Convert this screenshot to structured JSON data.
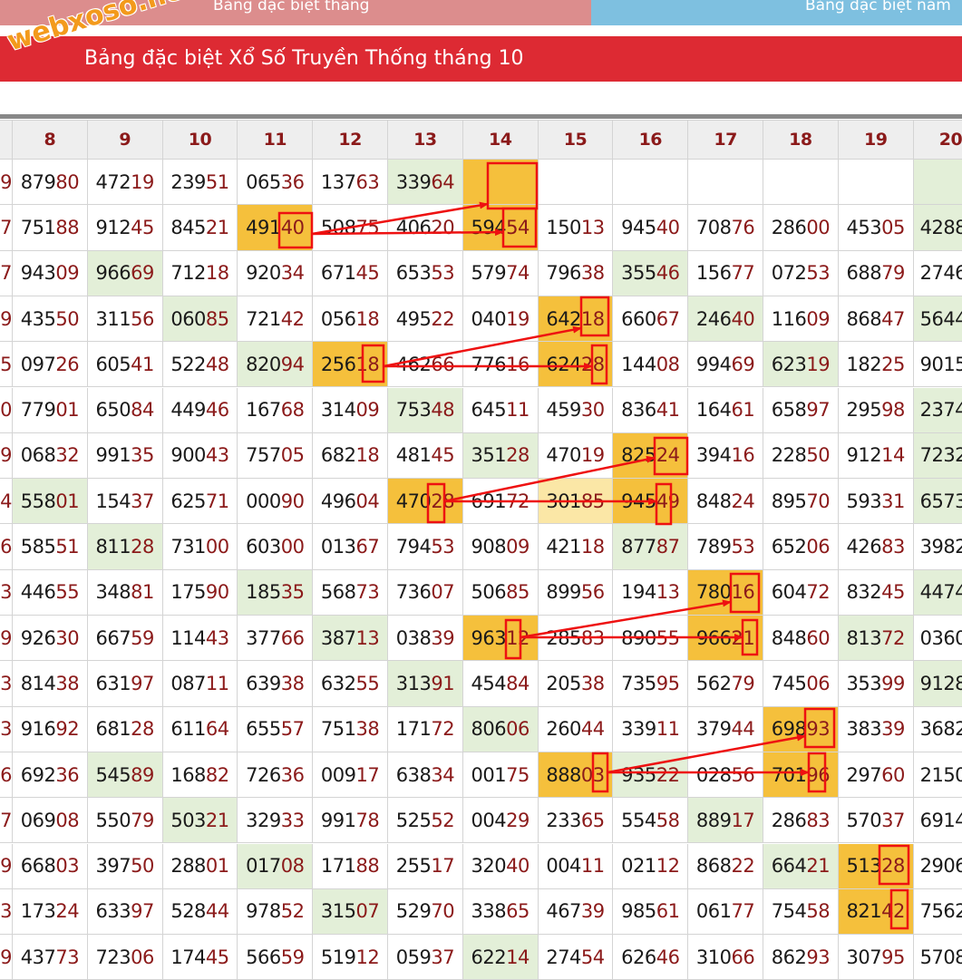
{
  "tabs": [
    {
      "label": "Bảng đặc biệt tháng",
      "color": "#dc8d8d"
    },
    {
      "label": "Bảng đặc biệt năm",
      "color": "#7ec0e0"
    }
  ],
  "watermark": "webxoso.net",
  "title": "Bảng đặc biệt Xổ Số Truyền Thống tháng 10",
  "colors": {
    "title_bg": "#dd2a33",
    "header_text": "#8b1a1a",
    "highlight_green": "#e3efd8",
    "highlight_orange": "#f5c03c",
    "highlight_pale": "#fbe7a6",
    "annotation": "#ee1111"
  },
  "table": {
    "left_edge_fragments": [
      "9",
      "7",
      "7",
      "9",
      "5",
      "0",
      "9",
      "4",
      "6",
      "3",
      "9",
      "3",
      "3",
      "6",
      "7",
      "9",
      "3",
      "9"
    ],
    "columns": [
      "8",
      "9",
      "10",
      "11",
      "12",
      "13",
      "14",
      "15",
      "16",
      "17",
      "18",
      "19",
      "20"
    ],
    "rows": [
      [
        "87980",
        "47219",
        "23951",
        "06536",
        "13763",
        "33964",
        "",
        "",
        "",
        "",
        "",
        "",
        ""
      ],
      [
        "75188",
        "91245",
        "84521",
        "49140",
        "50875",
        "40620",
        "59454",
        "15013",
        "94540",
        "70876",
        "28600",
        "45305",
        "4288"
      ],
      [
        "94309",
        "96669",
        "71218",
        "92034",
        "67145",
        "65353",
        "57974",
        "79638",
        "35546",
        "15677",
        "07253",
        "68879",
        "2746"
      ],
      [
        "43550",
        "31156",
        "06085",
        "72142",
        "05618",
        "49522",
        "04019",
        "64218",
        "66067",
        "24640",
        "11609",
        "86847",
        "5644"
      ],
      [
        "09726",
        "60541",
        "52248",
        "82094",
        "25618",
        "46266",
        "77616",
        "62428",
        "14408",
        "99469",
        "62319",
        "18225",
        "9015"
      ],
      [
        "77901",
        "65084",
        "44946",
        "16768",
        "31409",
        "75348",
        "64511",
        "45930",
        "83641",
        "16461",
        "65897",
        "29598",
        "2374"
      ],
      [
        "06832",
        "99135",
        "90043",
        "75705",
        "68218",
        "48145",
        "35128",
        "47019",
        "82524",
        "39416",
        "22850",
        "91214",
        "7232"
      ],
      [
        "55801",
        "15437",
        "62571",
        "00090",
        "49604",
        "47028",
        "69172",
        "30185",
        "94549",
        "84824",
        "89570",
        "59331",
        "6573"
      ],
      [
        "58551",
        "81128",
        "73100",
        "60300",
        "01367",
        "79453",
        "90809",
        "42118",
        "87787",
        "78953",
        "65206",
        "42683",
        "3982"
      ],
      [
        "44655",
        "34881",
        "17590",
        "18535",
        "56873",
        "73607",
        "50685",
        "89956",
        "19413",
        "78016",
        "60472",
        "83245",
        "4474"
      ],
      [
        "92630",
        "66759",
        "11443",
        "37766",
        "38713",
        "03839",
        "96312",
        "28583",
        "89055",
        "96621",
        "84860",
        "81372",
        "0360"
      ],
      [
        "81438",
        "63197",
        "08711",
        "63938",
        "63255",
        "31391",
        "45484",
        "20538",
        "73595",
        "56279",
        "74506",
        "35399",
        "9128"
      ],
      [
        "91692",
        "68128",
        "61164",
        "65557",
        "75138",
        "17172",
        "80606",
        "26044",
        "33911",
        "37944",
        "69893",
        "38339",
        "3682"
      ],
      [
        "69236",
        "54589",
        "16882",
        "72636",
        "00917",
        "63834",
        "00175",
        "88803",
        "93522",
        "02856",
        "70196",
        "29760",
        "2150"
      ],
      [
        "06908",
        "55079",
        "50321",
        "32933",
        "99178",
        "52552",
        "00429",
        "23365",
        "55458",
        "88917",
        "28683",
        "57037",
        "6914"
      ],
      [
        "66803",
        "39750",
        "28801",
        "01708",
        "17188",
        "25517",
        "32040",
        "00411",
        "02112",
        "86822",
        "66421",
        "51328",
        "2906"
      ],
      [
        "17324",
        "63397",
        "52844",
        "97852",
        "31507",
        "52970",
        "33865",
        "46739",
        "98561",
        "06177",
        "75458",
        "82142",
        "7562"
      ],
      [
        "43773",
        "72306",
        "17445",
        "56659",
        "51912",
        "05937",
        "62214",
        "27454",
        "62646",
        "31066",
        "86293",
        "30795",
        "5708"
      ]
    ],
    "green_cells": [
      [
        0,
        5
      ],
      [
        0,
        12
      ],
      [
        1,
        12
      ],
      [
        2,
        1
      ],
      [
        2,
        8
      ],
      [
        3,
        2
      ],
      [
        3,
        9
      ],
      [
        3,
        12
      ],
      [
        4,
        3
      ],
      [
        4,
        10
      ],
      [
        5,
        5
      ],
      [
        5,
        12
      ],
      [
        6,
        6
      ],
      [
        6,
        12
      ],
      [
        7,
        0
      ],
      [
        7,
        12
      ],
      [
        8,
        1
      ],
      [
        8,
        8
      ],
      [
        9,
        3
      ],
      [
        9,
        12
      ],
      [
        10,
        4
      ],
      [
        10,
        11
      ],
      [
        11,
        5
      ],
      [
        11,
        12
      ],
      [
        12,
        6
      ],
      [
        13,
        1
      ],
      [
        13,
        8
      ],
      [
        14,
        2
      ],
      [
        14,
        9
      ],
      [
        15,
        3
      ],
      [
        15,
        10
      ],
      [
        16,
        4
      ],
      [
        17,
        6
      ]
    ],
    "orange_cells": [
      [
        0,
        6
      ],
      [
        1,
        3
      ],
      [
        1,
        6
      ],
      [
        3,
        7
      ],
      [
        4,
        4
      ],
      [
        4,
        7
      ],
      [
        6,
        8
      ],
      [
        7,
        5
      ],
      [
        7,
        8
      ],
      [
        9,
        9
      ],
      [
        10,
        6
      ],
      [
        10,
        9
      ],
      [
        12,
        10
      ],
      [
        13,
        7
      ],
      [
        13,
        10
      ],
      [
        15,
        11
      ],
      [
        16,
        11
      ]
    ],
    "pale_cells": [
      [
        7,
        7
      ]
    ]
  }
}
